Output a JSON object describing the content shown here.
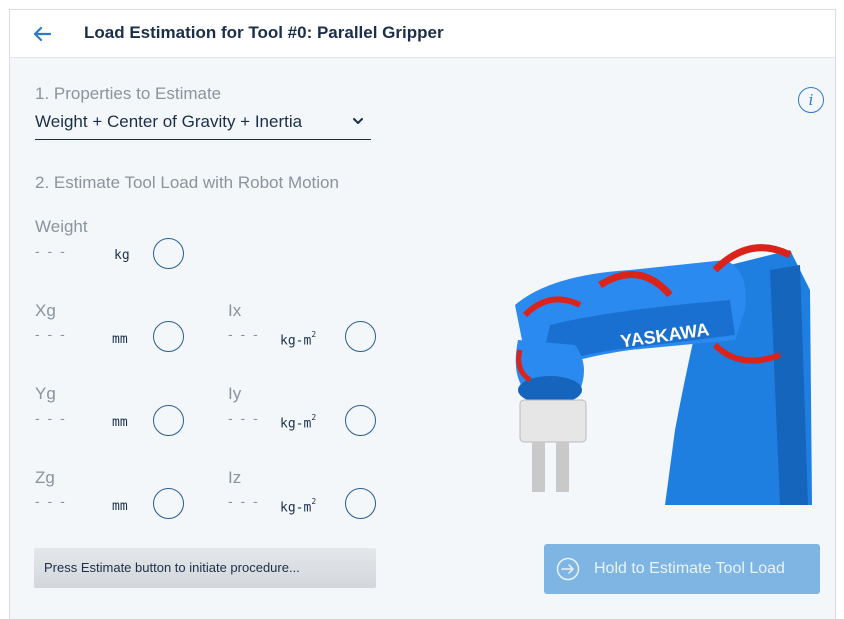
{
  "header": {
    "title": "Load Estimation for Tool #0: Parallel Gripper"
  },
  "section1": {
    "label": "1. Properties to Estimate",
    "select_value": "Weight + Center of Gravity + Inertia"
  },
  "section2": {
    "label": "2. Estimate Tool Load with Robot Motion"
  },
  "fields": {
    "weight": {
      "label": "Weight",
      "value": "- - -",
      "unit": "kg"
    },
    "xg": {
      "label": "Xg",
      "value": "- - -",
      "unit": "mm"
    },
    "yg": {
      "label": "Yg",
      "value": "- - -",
      "unit": "mm"
    },
    "zg": {
      "label": "Zg",
      "value": "- - -",
      "unit": "mm"
    },
    "ix": {
      "label": "Ix",
      "value": "- - -",
      "unit": "kg-m",
      "unit_sup": "2"
    },
    "iy": {
      "label": "Iy",
      "value": "- - -",
      "unit": "kg-m",
      "unit_sup": "2"
    },
    "iz": {
      "label": "Iz",
      "value": "- - -",
      "unit": "kg-m",
      "unit_sup": "2"
    }
  },
  "status": {
    "text": "Press Estimate button to initiate procedure..."
  },
  "estimate_button": {
    "label": "Hold to Estimate Tool Load",
    "enabled": false
  },
  "robot": {
    "brand": "YASKAWA"
  },
  "colors": {
    "accent": "#2e7bc8",
    "title": "#1b2f4a",
    "muted": "#8b939c",
    "robot_blue": "#1f7fe0",
    "arrow_red": "#d9231b"
  },
  "icons": {
    "back": "arrow-left-icon",
    "info": "info-icon",
    "chevron": "chevron-down-icon",
    "estimate": "arrow-right-circle-icon"
  }
}
